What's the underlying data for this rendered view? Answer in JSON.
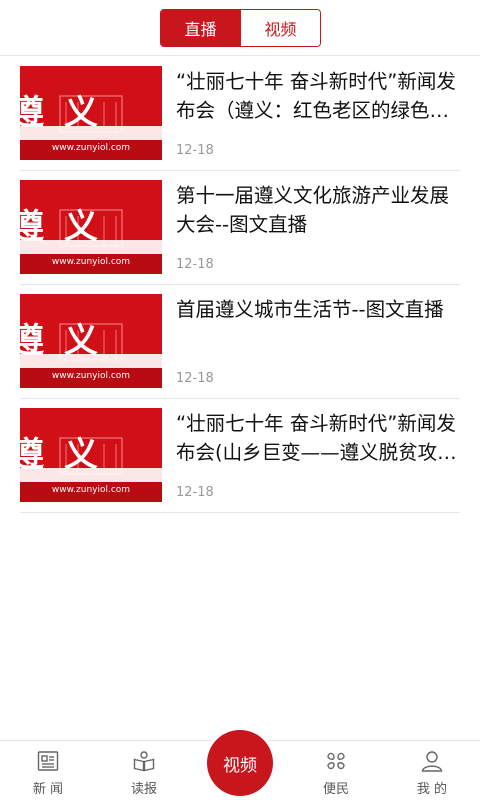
{
  "tabs": {
    "live_label": "直播",
    "video_label": "视频",
    "active": "live"
  },
  "thumbnail": {
    "site_text": "www.zunyiol.com",
    "logo_text": "遵义",
    "color": "#d10f16"
  },
  "news": [
    {
      "title": "“壮丽七十年 奋斗新时代”新闻发布会（遵义：红色老区的绿色发展之路）",
      "date": "12-18"
    },
    {
      "title": "第十一届遵义文化旅游产业发展大会--图文直播",
      "date": "12-18"
    },
    {
      "title": "首届遵义城市生活节--图文直播",
      "date": "12-18"
    },
    {
      "title": "“壮丽七十年 奋斗新时代”新闻发布会(山乡巨变——遵义脱贫攻坚)",
      "date": "12-18"
    }
  ],
  "bottom_nav": {
    "news_label": "新 闻",
    "news_icon": "newspaper-icon",
    "read_label": "读报",
    "read_icon": "book-icon",
    "video_label": "视频",
    "service_label": "便民",
    "service_icon": "grid-icon",
    "mine_label": "我 的",
    "mine_icon": "user-icon"
  },
  "colors": {
    "accent": "#c8161d",
    "divider": "#e6e6e6",
    "date_text": "#999999"
  }
}
